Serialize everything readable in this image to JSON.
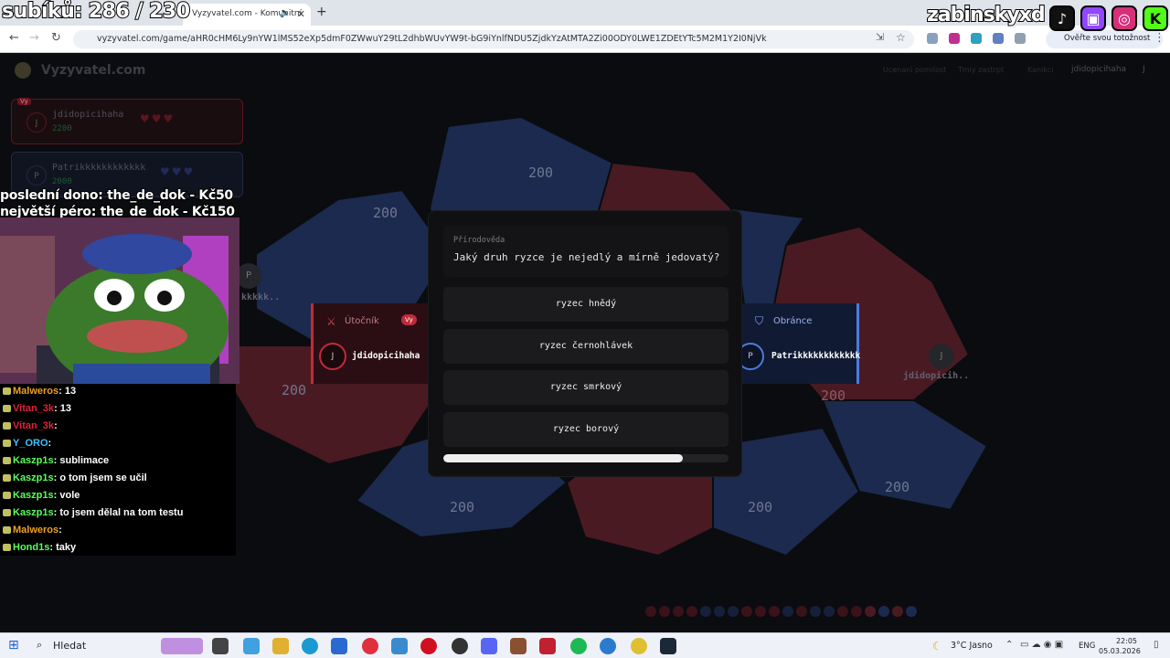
{
  "browser": {
    "tab_title": "Vyzyvatel.com - Komunitní",
    "url": "vyzyvatel.com/game/aHR0cHM6Ly9nYW1lMS52eXp5dmF0ZWwuY29tL2dhbWUvYW9t-bG9iYnlfNDU5ZjdkYzAtMTA2Zi00ODY0LWE1ZDEtYTc5M2M1Y2I0NjVk",
    "verify_label": "Ověřte svou totožnost"
  },
  "stream": {
    "sub_counter": "subíků: 286 / 230",
    "streamer": "zabinskyxd",
    "last_dono": "poslední dono: the_de_dok - Kč50",
    "biggest_dono": "největší péro: the_de_dok - Kč150"
  },
  "game": {
    "logo": "Vyzyvatel.com",
    "nav": [
      "Ucenanì pomilost",
      "Tmiy zastrpt",
      "Kanikci"
    ],
    "top_user": "jdidopicihaha",
    "top_user_initial": "J",
    "players": [
      {
        "initial": "J",
        "name": "jdidopicihaha",
        "score": "2200",
        "tag": "Vy"
      },
      {
        "initial": "P",
        "name": "Patrikkkkkkkkkkkk",
        "score": "2000"
      }
    ],
    "map": {
      "labels": [
        "200",
        "200",
        "200",
        "200",
        "200",
        "200",
        "200",
        "200"
      ],
      "owner_left": "kkkkk..",
      "owner_left_initial": "P",
      "owner_right": "jdidopicih..",
      "owner_right_initial": "J"
    },
    "attacker": {
      "title": "Útočník",
      "tag": "Vy",
      "initial": "J",
      "name": "jdidopicihaha"
    },
    "defender": {
      "title": "Obránce",
      "initial": "P",
      "name": "Patrikkkkkkkkkkkk"
    },
    "question": {
      "category": "Přírodověda",
      "text": "Jaký druh ryzce je nejedlý a mírně jedovatý?",
      "answers": [
        "ryzec hnědý",
        "ryzec černohlávek",
        "ryzec smrkový",
        "ryzec borový"
      ],
      "time_remaining_fraction": 0.84
    }
  },
  "chat": [
    {
      "user": "Malweros",
      "color": "#f0a020",
      "msg": ": 13"
    },
    {
      "user": "Vitan_3k",
      "color": "#e0203a",
      "msg": ": 13"
    },
    {
      "user": "Vitan_3k",
      "color": "#e0203a",
      "msg": ": "
    },
    {
      "user": "Y_ORO",
      "color": "#40c0ff",
      "msg": ": "
    },
    {
      "user": "Kaszp1s",
      "color": "#5aff5a",
      "msg": ": sublimace"
    },
    {
      "user": "Kaszp1s",
      "color": "#5aff5a",
      "msg": ": o tom jsem se učil"
    },
    {
      "user": "Kaszp1s",
      "color": "#5aff5a",
      "msg": ": vole"
    },
    {
      "user": "Kaszp1s",
      "color": "#5aff5a",
      "msg": ": to jsem dělal na tom testu"
    },
    {
      "user": "Malweros",
      "color": "#f0a020",
      "msg": ": "
    },
    {
      "user": "Hond1s",
      "color": "#5aff5a",
      "msg": ": taky"
    }
  ],
  "taskbar": {
    "search": "Hledat",
    "weather": "3°C Jasno",
    "lang": "ENG",
    "time": "22:05",
    "date": "05.03.2026"
  },
  "colors": {
    "red_region": "#4a1a22",
    "blue_region": "#1b2a4e",
    "attacker": "#c22a3a",
    "defender": "#4d7bd8"
  }
}
